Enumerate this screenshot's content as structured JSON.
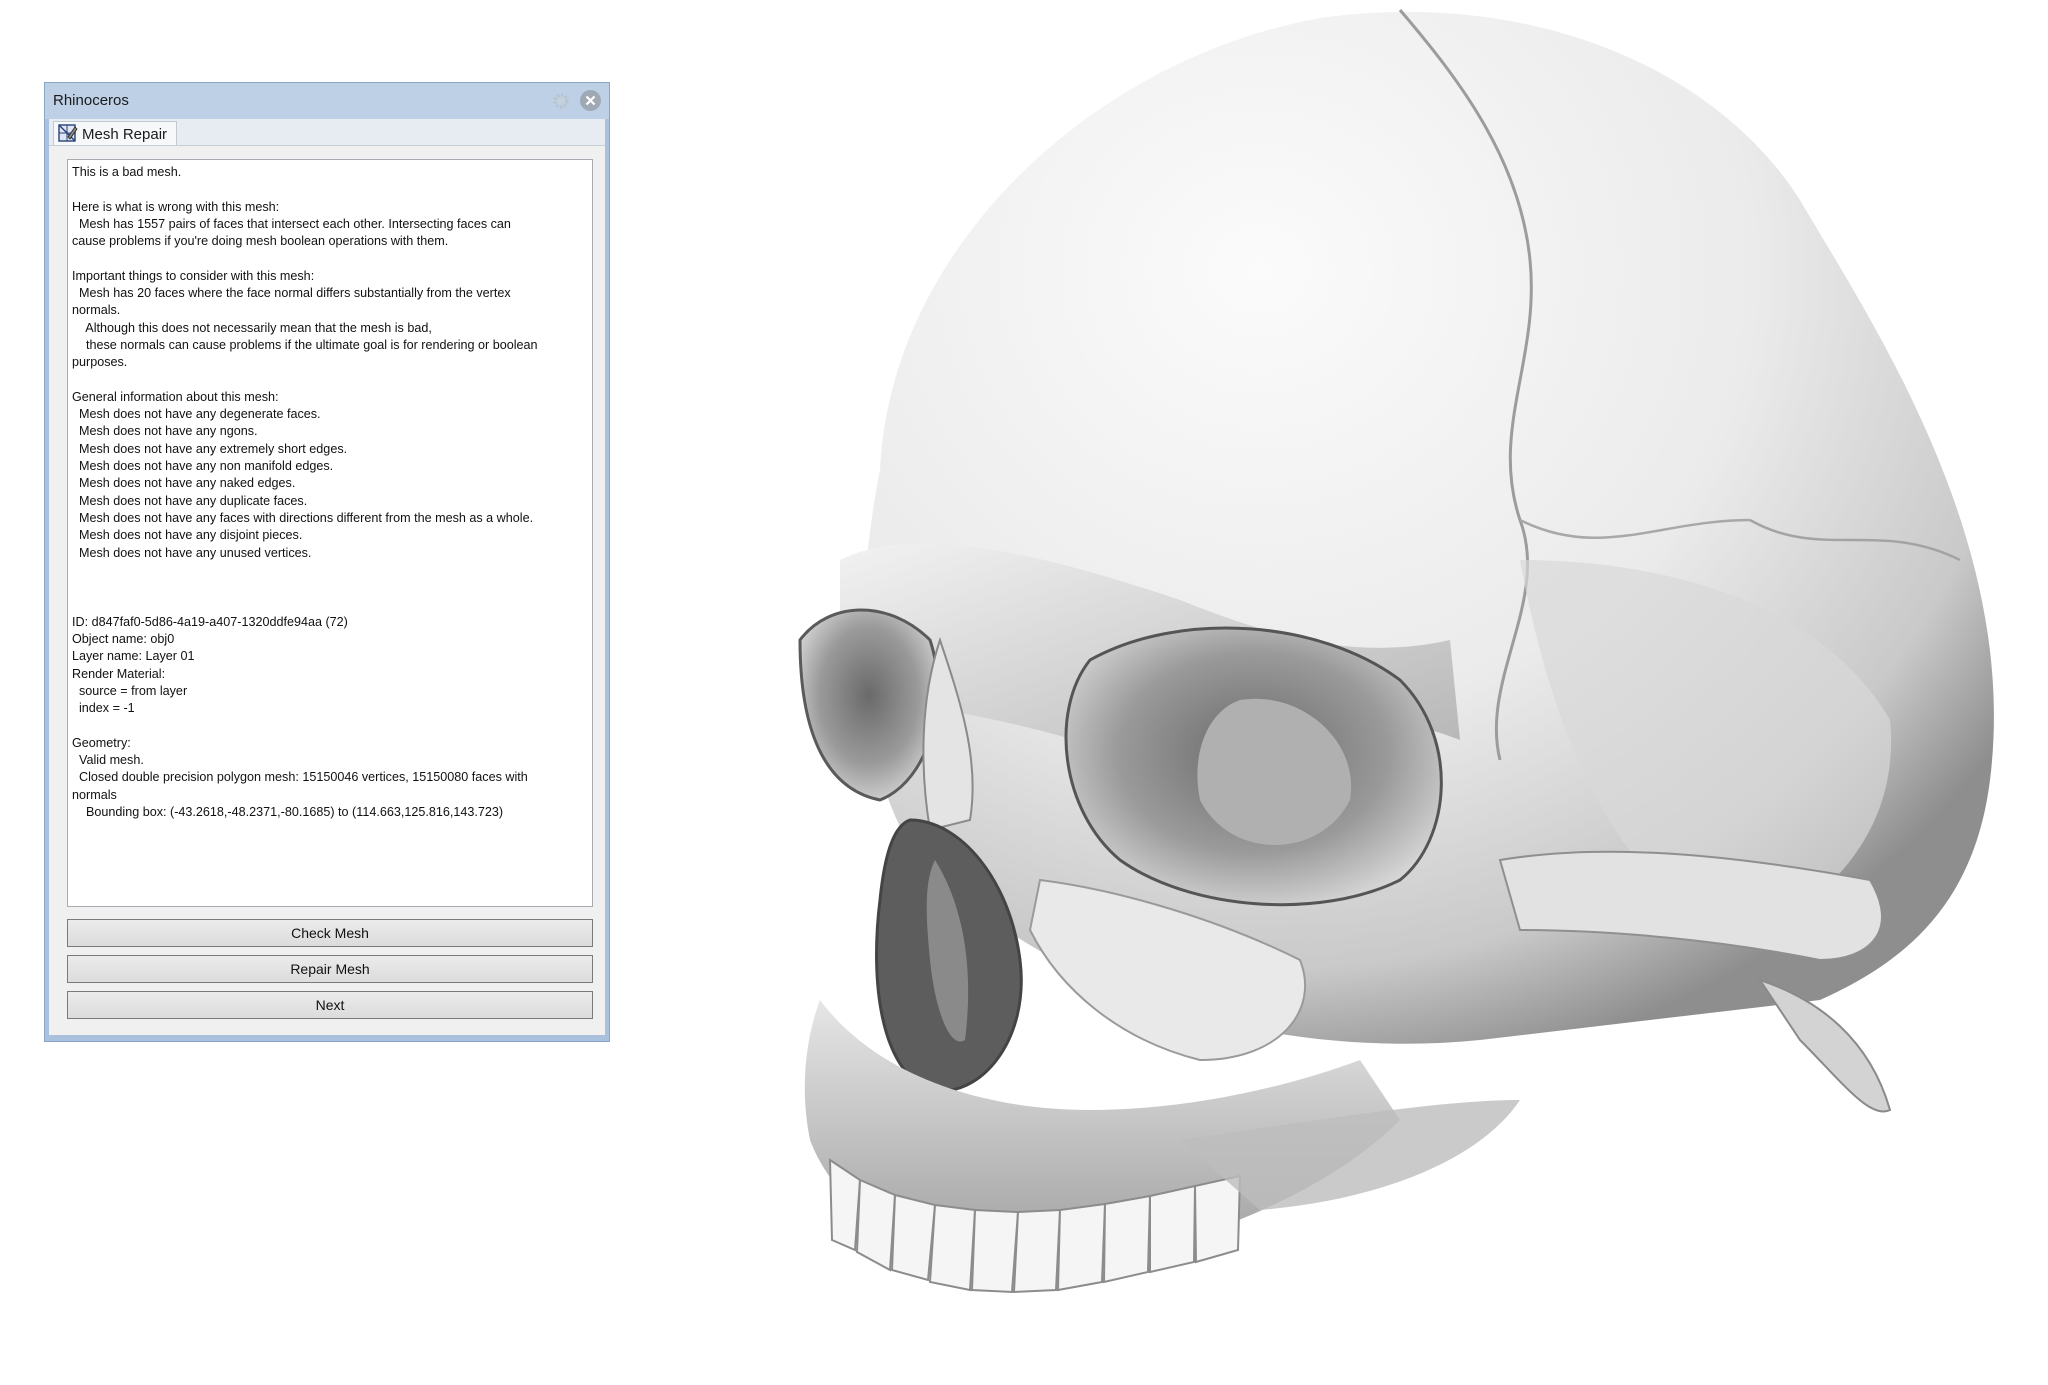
{
  "window": {
    "title": "Rhinoceros",
    "tab_label": "Mesh Repair"
  },
  "report": {
    "lines": [
      "This is a bad mesh.",
      "",
      "Here is what is wrong with this mesh:",
      "  Mesh has 1557 pairs of faces that intersect each other. Intersecting faces can",
      "cause problems if you're doing mesh boolean operations with them.",
      "",
      "Important things to consider with this mesh:",
      "  Mesh has 20 faces where the face normal differs substantially from the vertex",
      "normals.",
      "    Although this does not necessarily mean that the mesh is bad,",
      "    these normals can cause problems if the ultimate goal is for rendering or boolean",
      "purposes.",
      "",
      "General information about this mesh:",
      "  Mesh does not have any degenerate faces.",
      "  Mesh does not have any ngons.",
      "  Mesh does not have any extremely short edges.",
      "  Mesh does not have any non manifold edges.",
      "  Mesh does not have any naked edges.",
      "  Mesh does not have any duplicate faces.",
      "  Mesh does not have any faces with directions different from the mesh as a whole.",
      "  Mesh does not have any disjoint pieces.",
      "  Mesh does not have any unused vertices.",
      "",
      "",
      "",
      "ID: d847faf0-5d86-4a19-a407-1320ddfe94aa (72)",
      "Object name: obj0",
      "Layer name: Layer 01",
      "Render Material:",
      "  source = from layer",
      "  index = -1",
      "",
      "Geometry:",
      "  Valid mesh.",
      "  Closed double precision polygon mesh: 15150046 vertices, 15150080 faces with",
      "normals",
      "    Bounding box: (-43.2618,-48.2371,-80.1685) to (114.663,125.816,143.723)"
    ]
  },
  "buttons": {
    "check": "Check Mesh",
    "repair": "Repair Mesh",
    "next": "Next"
  },
  "icons": {
    "gear": "gear-icon",
    "close": "close-icon",
    "tab": "mesh-repair-icon"
  },
  "colors": {
    "window_frame": "#a9c1dc",
    "titlebar": "#bdd0e6",
    "client_bg": "#f0f0f0",
    "skull_light": "#f4f4f4",
    "skull_shadow": "#5a5a5a"
  }
}
